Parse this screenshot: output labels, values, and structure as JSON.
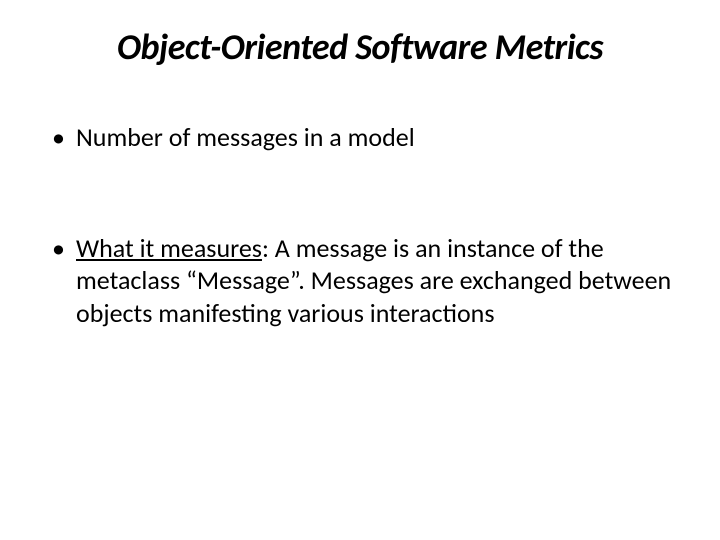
{
  "slide": {
    "title": "Object-Oriented Software Metrics",
    "bullets": [
      {
        "text": "Number of messages in a model"
      },
      {
        "label": "What it measures",
        "text": ": A message is an instance of the metaclass “Message”. Messages are exchanged between objects manifesting various interactions"
      }
    ]
  }
}
